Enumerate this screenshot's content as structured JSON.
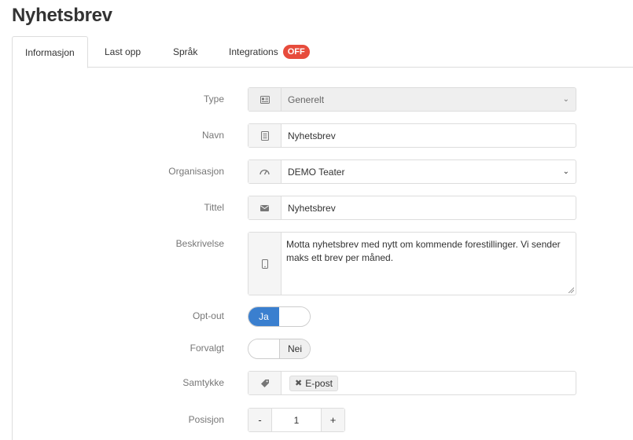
{
  "page": {
    "title": "Nyhetsbrev"
  },
  "tabs": [
    {
      "label": "Informasjon",
      "active": true
    },
    {
      "label": "Last opp"
    },
    {
      "label": "Språk"
    },
    {
      "label": "Integrations",
      "badge": "OFF"
    }
  ],
  "form": {
    "type": {
      "label": "Type",
      "value": "Generelt",
      "icon": "id-card-icon",
      "disabled": true
    },
    "navn": {
      "label": "Navn",
      "value": "Nyhetsbrev",
      "icon": "document-icon"
    },
    "organisasjon": {
      "label": "Organisasjon",
      "value": "DEMO Teater",
      "icon": "gauge-icon"
    },
    "tittel": {
      "label": "Tittel",
      "value": "Nyhetsbrev",
      "icon": "envelope-icon"
    },
    "beskrivelse": {
      "label": "Beskrivelse",
      "value": "Motta nyhetsbrev med nytt om kommende forestillinger. Vi sender maks ett brev per måned.",
      "icon": "mobile-icon"
    },
    "optout": {
      "label": "Opt-out",
      "on_label": "Ja",
      "state": "on"
    },
    "forvalgt": {
      "label": "Forvalgt",
      "off_label": "Nei",
      "state": "off"
    },
    "samtykke": {
      "label": "Samtykke",
      "icon": "tag-icon",
      "tags": [
        "E-post"
      ]
    },
    "posisjon": {
      "label": "Posisjon",
      "value": "1",
      "minus": "-",
      "plus": "+"
    }
  },
  "colors": {
    "accent": "#3a7fcf",
    "badge_off": "#e74c3c"
  }
}
